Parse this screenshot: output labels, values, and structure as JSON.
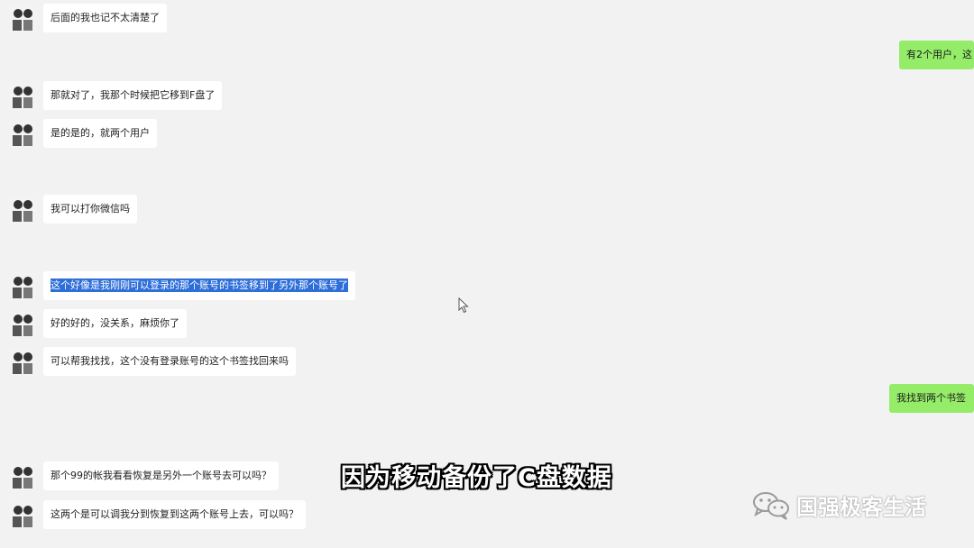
{
  "messages": [
    {
      "text": "后面的我也记不太清楚了"
    },
    {
      "text": "那就对了，我那个时候把它移到F盘了"
    },
    {
      "text": "是的是的，就两个用户"
    },
    {
      "text": "我可以打你微信吗"
    },
    {
      "text": "这个好像是我刚刚可以登录的那个账号的书签移到了另外那个账号了",
      "selected": true
    },
    {
      "text": "好的好的，没关系，麻烦你了"
    },
    {
      "text": "可以帮我找找，这个没有登录账号的这个书签找回来吗"
    },
    {
      "text": "那个99的帐我看看恢复是另外一个账号去可以吗？"
    },
    {
      "text": "这两个是可以调我分到恢复到这两个账号上去，可以吗？"
    }
  ],
  "outgoing": [
    {
      "text": "有2个用户，这"
    },
    {
      "text": "我找到两个书签"
    }
  ],
  "subtitle": "因为移动备份了C盘数据",
  "watermark": {
    "text": "国强极客生活",
    "icon": "wechat-icon"
  },
  "colors": {
    "incoming_bubble": "#ffffff",
    "outgoing_bubble": "#95ec69",
    "selection": "#2d6ed8",
    "background": "#f2f2f2"
  }
}
